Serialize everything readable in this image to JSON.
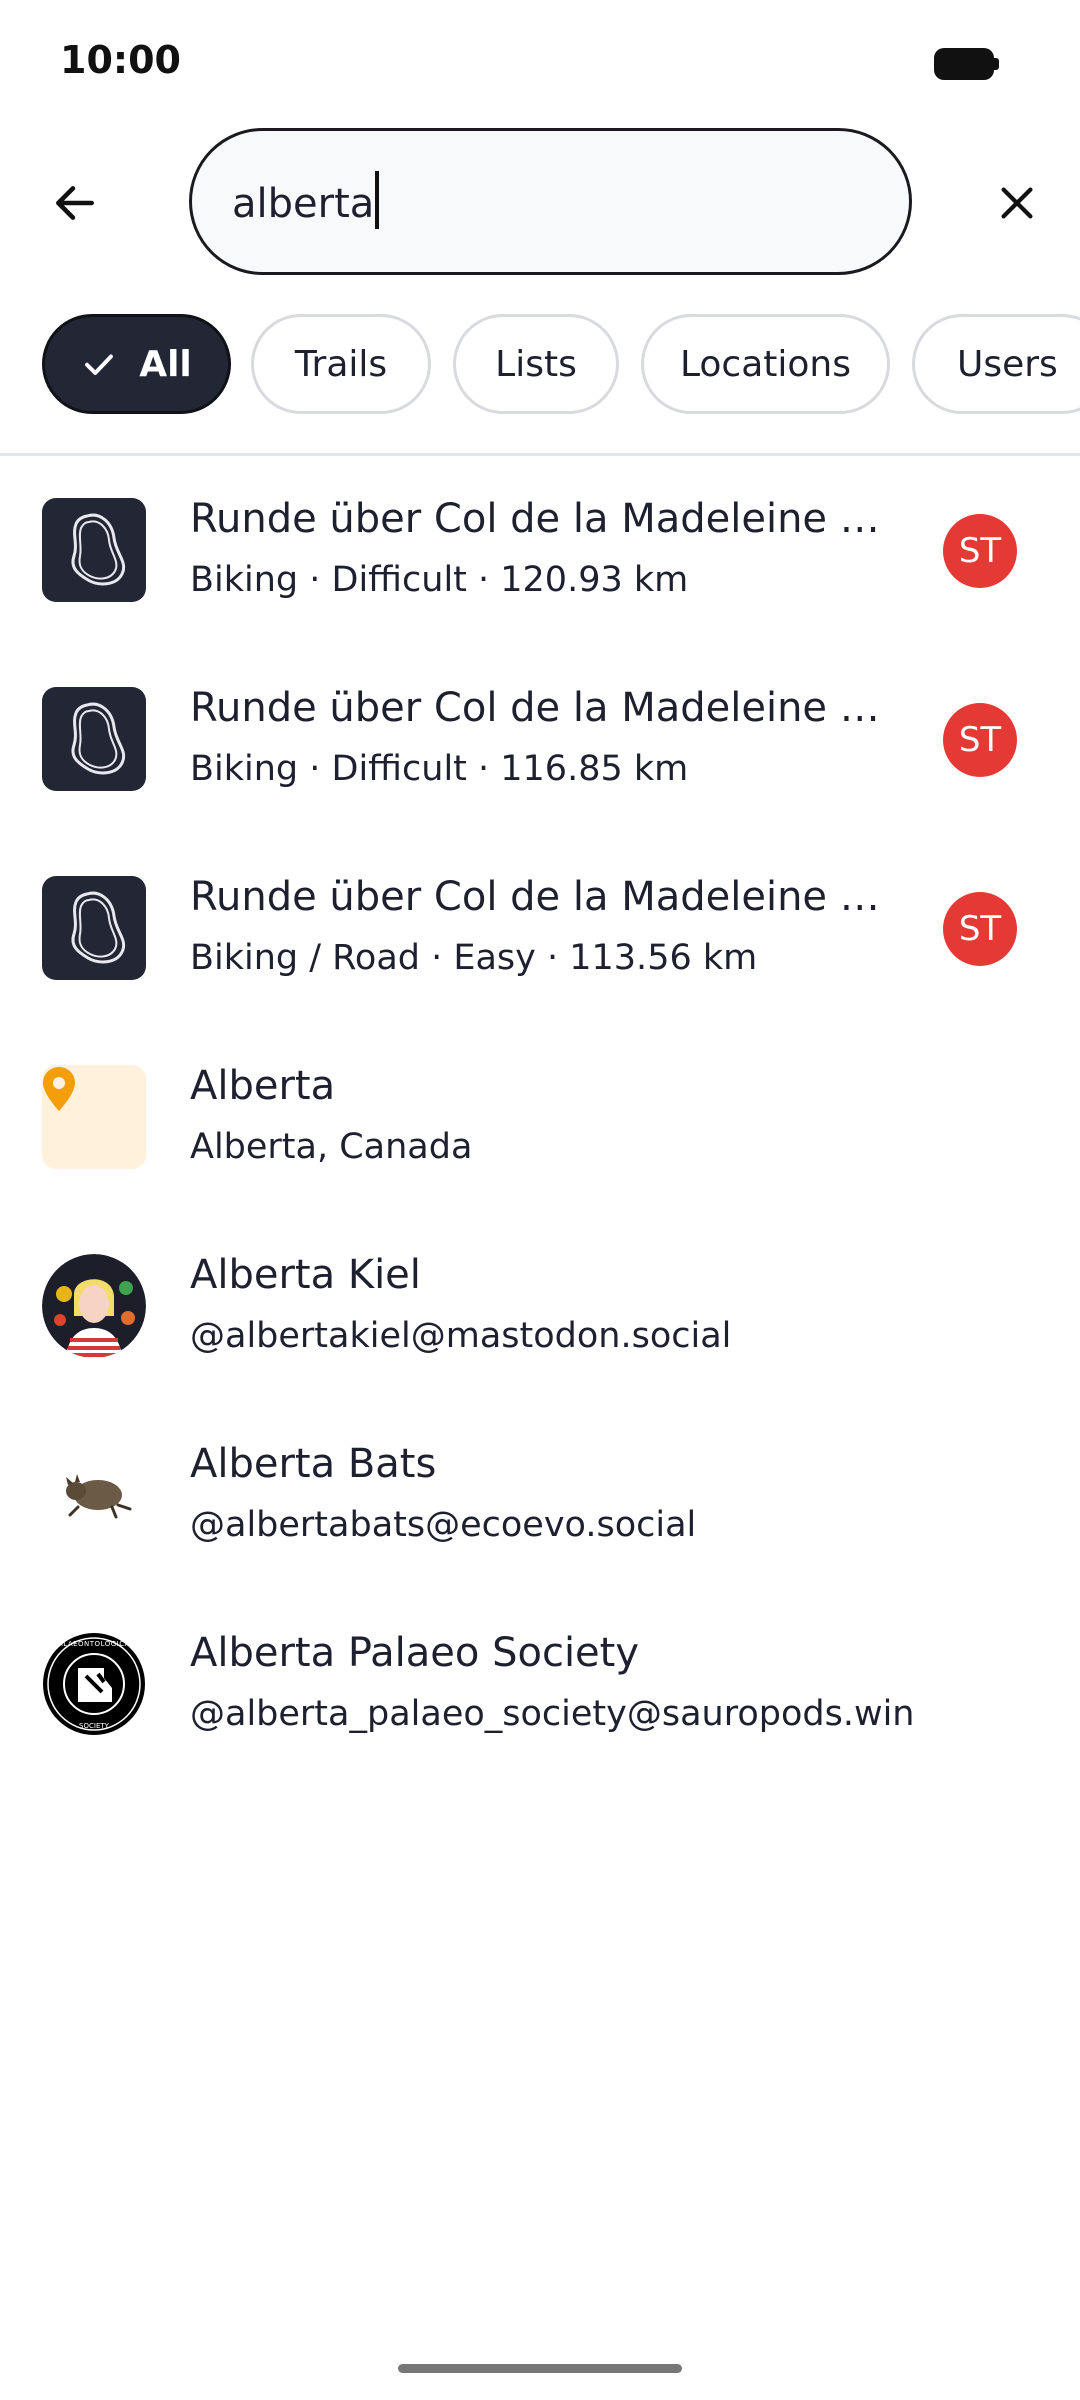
{
  "status_bar": {
    "time": "10:00"
  },
  "search": {
    "query": "alberta"
  },
  "filters": [
    {
      "label": "All",
      "selected": true
    },
    {
      "label": "Trails",
      "selected": false
    },
    {
      "label": "Lists",
      "selected": false
    },
    {
      "label": "Locations",
      "selected": false
    },
    {
      "label": "Users",
      "selected": false
    }
  ],
  "results": [
    {
      "kind": "trail",
      "icon": "route-icon",
      "title": "Runde über Col de la Madeleine und Col de la Croix de Fer",
      "subtitle": "Biking · Difficult · 120.93 km",
      "avatar": "ST"
    },
    {
      "kind": "trail",
      "icon": "route-icon",
      "title": "Runde über Col de la Madeleine und Col de la Croix de Fer",
      "subtitle": "Biking · Difficult · 116.85 km",
      "avatar": "ST"
    },
    {
      "kind": "trail",
      "icon": "route-icon",
      "title": "Runde über Col de la Madeleine und Col de la Croix de Fer",
      "subtitle": "Biking / Road · Easy · 113.56 km",
      "avatar": "ST"
    },
    {
      "kind": "location",
      "icon": "map-pin-icon",
      "title": "Alberta",
      "subtitle": "Alberta, Canada"
    },
    {
      "kind": "user",
      "icon": "user-avatar",
      "title": "Alberta Kiel",
      "subtitle": "@albertakiel@mastodon.social"
    },
    {
      "kind": "user",
      "icon": "user-avatar",
      "title": "Alberta Bats",
      "subtitle": "@albertabats@ecoevo.social"
    },
    {
      "kind": "user",
      "icon": "user-avatar",
      "title": "Alberta Palaeo Society",
      "subtitle": "@alberta_palaeo_society@sauropods.win",
      "logo_text": "ALBERTA PALAEONTOLOGICAL SOCIETY"
    }
  ],
  "colors": {
    "chip_selected": "#232635",
    "avatar_badge": "#e53935",
    "location_pin": "#f59e0b",
    "location_bg": "#fff1dc"
  }
}
